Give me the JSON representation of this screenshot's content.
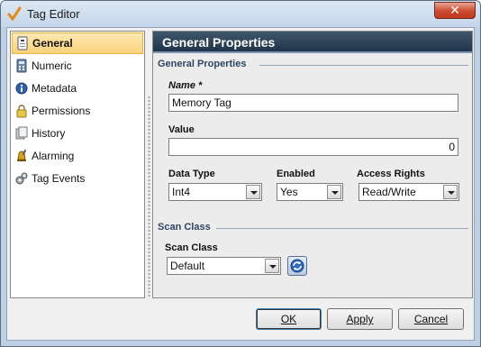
{
  "window": {
    "title": "Tag Editor",
    "close_glyph": "✕"
  },
  "sidebar": {
    "items": [
      {
        "label": "General",
        "icon": "tag-icon",
        "active": true
      },
      {
        "label": "Numeric",
        "icon": "calculator-icon",
        "active": false
      },
      {
        "label": "Metadata",
        "icon": "info-icon",
        "active": false
      },
      {
        "label": "Permissions",
        "icon": "lock-icon",
        "active": false
      },
      {
        "label": "History",
        "icon": "history-icon",
        "active": false
      },
      {
        "label": "Alarming",
        "icon": "bell-icon",
        "active": false
      },
      {
        "label": "Tag Events",
        "icon": "gears-icon",
        "active": false
      }
    ]
  },
  "main": {
    "header": "General Properties",
    "general_section": "General Properties",
    "name_label": "Name *",
    "name_value": "Memory Tag",
    "value_label": "Value",
    "value_value": "0",
    "data_type_label": "Data Type",
    "data_type_value": "Int4",
    "enabled_label": "Enabled",
    "enabled_value": "Yes",
    "access_label": "Access Rights",
    "access_value": "Read/Write",
    "scan_section": "Scan Class",
    "scan_label": "Scan Class",
    "scan_value": "Default"
  },
  "buttons": {
    "ok": "OK",
    "apply": "Apply",
    "cancel": "Cancel"
  },
  "colors": {
    "header_bg": "#1f3448",
    "active_nav": "#f9d27b",
    "close_btn": "#cc4b30"
  }
}
